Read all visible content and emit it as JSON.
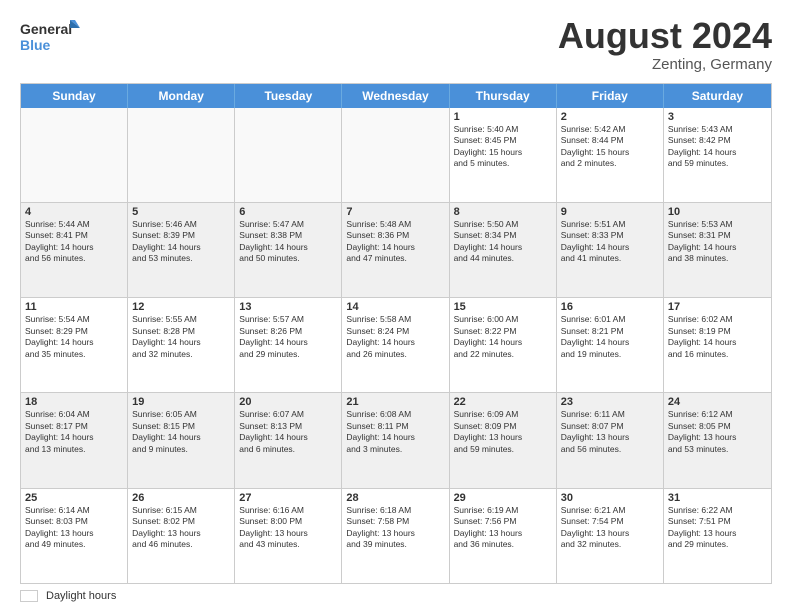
{
  "logo": {
    "line1": "General",
    "line2": "Blue"
  },
  "title": "August 2024",
  "subtitle": "Zenting, Germany",
  "days_of_week": [
    "Sunday",
    "Monday",
    "Tuesday",
    "Wednesday",
    "Thursday",
    "Friday",
    "Saturday"
  ],
  "footer_label": "Daylight hours",
  "weeks": [
    [
      {
        "num": "",
        "info": "",
        "empty": true
      },
      {
        "num": "",
        "info": "",
        "empty": true
      },
      {
        "num": "",
        "info": "",
        "empty": true
      },
      {
        "num": "",
        "info": "",
        "empty": true
      },
      {
        "num": "1",
        "info": "Sunrise: 5:40 AM\nSunset: 8:45 PM\nDaylight: 15 hours\nand 5 minutes.",
        "empty": false
      },
      {
        "num": "2",
        "info": "Sunrise: 5:42 AM\nSunset: 8:44 PM\nDaylight: 15 hours\nand 2 minutes.",
        "empty": false
      },
      {
        "num": "3",
        "info": "Sunrise: 5:43 AM\nSunset: 8:42 PM\nDaylight: 14 hours\nand 59 minutes.",
        "empty": false
      }
    ],
    [
      {
        "num": "4",
        "info": "Sunrise: 5:44 AM\nSunset: 8:41 PM\nDaylight: 14 hours\nand 56 minutes.",
        "empty": false
      },
      {
        "num": "5",
        "info": "Sunrise: 5:46 AM\nSunset: 8:39 PM\nDaylight: 14 hours\nand 53 minutes.",
        "empty": false
      },
      {
        "num": "6",
        "info": "Sunrise: 5:47 AM\nSunset: 8:38 PM\nDaylight: 14 hours\nand 50 minutes.",
        "empty": false
      },
      {
        "num": "7",
        "info": "Sunrise: 5:48 AM\nSunset: 8:36 PM\nDaylight: 14 hours\nand 47 minutes.",
        "empty": false
      },
      {
        "num": "8",
        "info": "Sunrise: 5:50 AM\nSunset: 8:34 PM\nDaylight: 14 hours\nand 44 minutes.",
        "empty": false
      },
      {
        "num": "9",
        "info": "Sunrise: 5:51 AM\nSunset: 8:33 PM\nDaylight: 14 hours\nand 41 minutes.",
        "empty": false
      },
      {
        "num": "10",
        "info": "Sunrise: 5:53 AM\nSunset: 8:31 PM\nDaylight: 14 hours\nand 38 minutes.",
        "empty": false
      }
    ],
    [
      {
        "num": "11",
        "info": "Sunrise: 5:54 AM\nSunset: 8:29 PM\nDaylight: 14 hours\nand 35 minutes.",
        "empty": false
      },
      {
        "num": "12",
        "info": "Sunrise: 5:55 AM\nSunset: 8:28 PM\nDaylight: 14 hours\nand 32 minutes.",
        "empty": false
      },
      {
        "num": "13",
        "info": "Sunrise: 5:57 AM\nSunset: 8:26 PM\nDaylight: 14 hours\nand 29 minutes.",
        "empty": false
      },
      {
        "num": "14",
        "info": "Sunrise: 5:58 AM\nSunset: 8:24 PM\nDaylight: 14 hours\nand 26 minutes.",
        "empty": false
      },
      {
        "num": "15",
        "info": "Sunrise: 6:00 AM\nSunset: 8:22 PM\nDaylight: 14 hours\nand 22 minutes.",
        "empty": false
      },
      {
        "num": "16",
        "info": "Sunrise: 6:01 AM\nSunset: 8:21 PM\nDaylight: 14 hours\nand 19 minutes.",
        "empty": false
      },
      {
        "num": "17",
        "info": "Sunrise: 6:02 AM\nSunset: 8:19 PM\nDaylight: 14 hours\nand 16 minutes.",
        "empty": false
      }
    ],
    [
      {
        "num": "18",
        "info": "Sunrise: 6:04 AM\nSunset: 8:17 PM\nDaylight: 14 hours\nand 13 minutes.",
        "empty": false
      },
      {
        "num": "19",
        "info": "Sunrise: 6:05 AM\nSunset: 8:15 PM\nDaylight: 14 hours\nand 9 minutes.",
        "empty": false
      },
      {
        "num": "20",
        "info": "Sunrise: 6:07 AM\nSunset: 8:13 PM\nDaylight: 14 hours\nand 6 minutes.",
        "empty": false
      },
      {
        "num": "21",
        "info": "Sunrise: 6:08 AM\nSunset: 8:11 PM\nDaylight: 14 hours\nand 3 minutes.",
        "empty": false
      },
      {
        "num": "22",
        "info": "Sunrise: 6:09 AM\nSunset: 8:09 PM\nDaylight: 13 hours\nand 59 minutes.",
        "empty": false
      },
      {
        "num": "23",
        "info": "Sunrise: 6:11 AM\nSunset: 8:07 PM\nDaylight: 13 hours\nand 56 minutes.",
        "empty": false
      },
      {
        "num": "24",
        "info": "Sunrise: 6:12 AM\nSunset: 8:05 PM\nDaylight: 13 hours\nand 53 minutes.",
        "empty": false
      }
    ],
    [
      {
        "num": "25",
        "info": "Sunrise: 6:14 AM\nSunset: 8:03 PM\nDaylight: 13 hours\nand 49 minutes.",
        "empty": false
      },
      {
        "num": "26",
        "info": "Sunrise: 6:15 AM\nSunset: 8:02 PM\nDaylight: 13 hours\nand 46 minutes.",
        "empty": false
      },
      {
        "num": "27",
        "info": "Sunrise: 6:16 AM\nSunset: 8:00 PM\nDaylight: 13 hours\nand 43 minutes.",
        "empty": false
      },
      {
        "num": "28",
        "info": "Sunrise: 6:18 AM\nSunset: 7:58 PM\nDaylight: 13 hours\nand 39 minutes.",
        "empty": false
      },
      {
        "num": "29",
        "info": "Sunrise: 6:19 AM\nSunset: 7:56 PM\nDaylight: 13 hours\nand 36 minutes.",
        "empty": false
      },
      {
        "num": "30",
        "info": "Sunrise: 6:21 AM\nSunset: 7:54 PM\nDaylight: 13 hours\nand 32 minutes.",
        "empty": false
      },
      {
        "num": "31",
        "info": "Sunrise: 6:22 AM\nSunset: 7:51 PM\nDaylight: 13 hours\nand 29 minutes.",
        "empty": false
      }
    ]
  ]
}
